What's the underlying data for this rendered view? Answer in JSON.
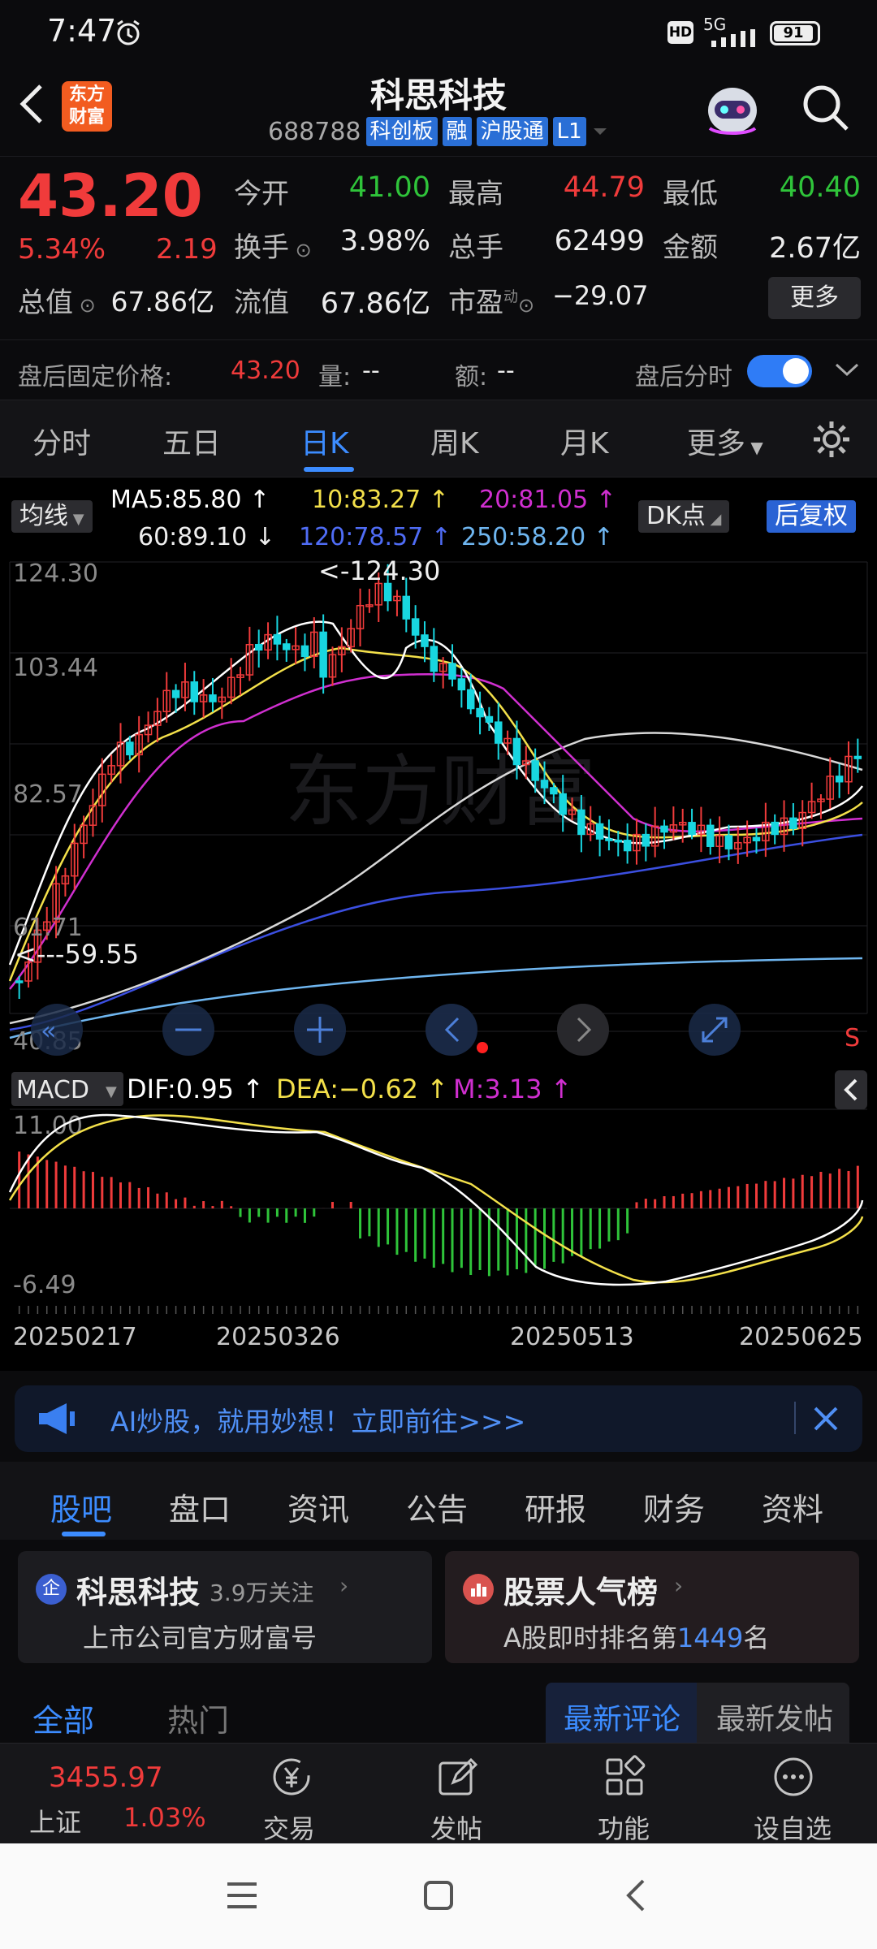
{
  "status": {
    "time": "7:47",
    "network": "5G",
    "battery": "91"
  },
  "header": {
    "logo_text": "东方\n财富",
    "title": "科思科技",
    "code": "688788",
    "tags": [
      "科创板",
      "融",
      "沪股通",
      "L1"
    ]
  },
  "quote": {
    "price": "43.20",
    "change_pct": "5.34%",
    "change": "2.19",
    "open_label": "今开",
    "open": "41.00",
    "high_label": "最高",
    "high": "44.79",
    "low_label": "最低",
    "low": "40.40",
    "turnover_label": "换手",
    "turnover": "3.98%",
    "volume_label": "总手",
    "volume": "62499",
    "amount_label": "金额",
    "amount": "2.67亿",
    "mktcap_label": "总值",
    "mktcap": "67.86亿",
    "float_label": "流值",
    "float": "67.86亿",
    "pe_label": "市盈",
    "pe_sup": "动",
    "pe": "−29.07",
    "more_label": "更多"
  },
  "afterhours": {
    "label": "盘后固定价格:",
    "price": "43.20",
    "vol_label": "量:",
    "vol": "--",
    "amt_label": "额:",
    "amt": "--",
    "timeshare_label": "盘后分时"
  },
  "ktabs": [
    "分时",
    "五日",
    "日K",
    "周K",
    "月K",
    "更多"
  ],
  "legend": {
    "ma_selector": "均线",
    "ma5": "MA5:85.80 ↑",
    "ma10": "10:83.27 ↑",
    "ma20": "20:81.05 ↑",
    "ma60": "60:89.10 ↓",
    "ma120": "120:78.57 ↑",
    "ma250": "250:58.20 ↑",
    "dk_label": "DK点",
    "fq_label": "后复权"
  },
  "colors": {
    "up": "#f03b3b",
    "down": "#18d6e0",
    "ma5": "#ffffff",
    "ma10": "#f3e04a",
    "ma20": "#d02fd0",
    "ma60": "#d8d8d8",
    "ma120": "#3b4fe0",
    "ma250": "#6fb6f0",
    "accent": "#3c8cff"
  },
  "chart_labels": {
    "max_label": "<-124.30",
    "min_label": "<---59.55",
    "y_ticks": [
      "124.30",
      "103.44",
      "82.57",
      "61.71",
      "40.85"
    ],
    "macd_selector": "MACD",
    "dif": "DIF:0.95 ↑",
    "dea": "DEA:−0.62 ↑",
    "m": "M:3.13 ↑",
    "macd_ticks": [
      "11.00",
      "-6.49"
    ],
    "dates": [
      "20250217",
      "20250326",
      "20250513",
      "20250625"
    ],
    "s_marker": "S",
    "watermark": "东方财富"
  },
  "chart_data": {
    "type": "candlestick",
    "ylim": [
      40.85,
      124.3
    ],
    "y_ticks": [
      124.3,
      103.44,
      82.57,
      61.71,
      40.85
    ],
    "x_ticks": [
      "20250217",
      "20250326",
      "20250513",
      "20250625"
    ],
    "max_price": 124.3,
    "min_price": 59.55,
    "last_close": 43.2,
    "indicators": {
      "MA5": 85.8,
      "MA10": 83.27,
      "MA20": 81.05,
      "MA60": 89.1,
      "MA120": 78.57,
      "MA250": 58.2
    },
    "macd": {
      "ylim": [
        -6.49,
        11.0
      ],
      "DIF": 0.95,
      "DEA": -0.62,
      "M": 3.13
    }
  },
  "banner": {
    "text": "AI炒股，就用妙想！立即前往>>>"
  },
  "infotabs": [
    "股吧",
    "盘口",
    "资讯",
    "公告",
    "研报",
    "财务",
    "资料"
  ],
  "cards": {
    "company": {
      "badge": "企",
      "title": "科思科技",
      "followers": "3.9万关注",
      "sub": "上市公司官方财富号"
    },
    "ranking": {
      "title": "股票人气榜",
      "sub_prefix": "A股即时排名第",
      "rank": "1449",
      "sub_suffix": "名"
    }
  },
  "filters": {
    "all": "全部",
    "hot": "热门",
    "latest_comment": "最新评论",
    "latest_post": "最新发帖"
  },
  "bottom": {
    "index_value": "3455.97",
    "index_name": "上证",
    "index_change": "1.03%",
    "trade": "交易",
    "post": "发帖",
    "features": "功能",
    "watchlist": "设自选"
  }
}
